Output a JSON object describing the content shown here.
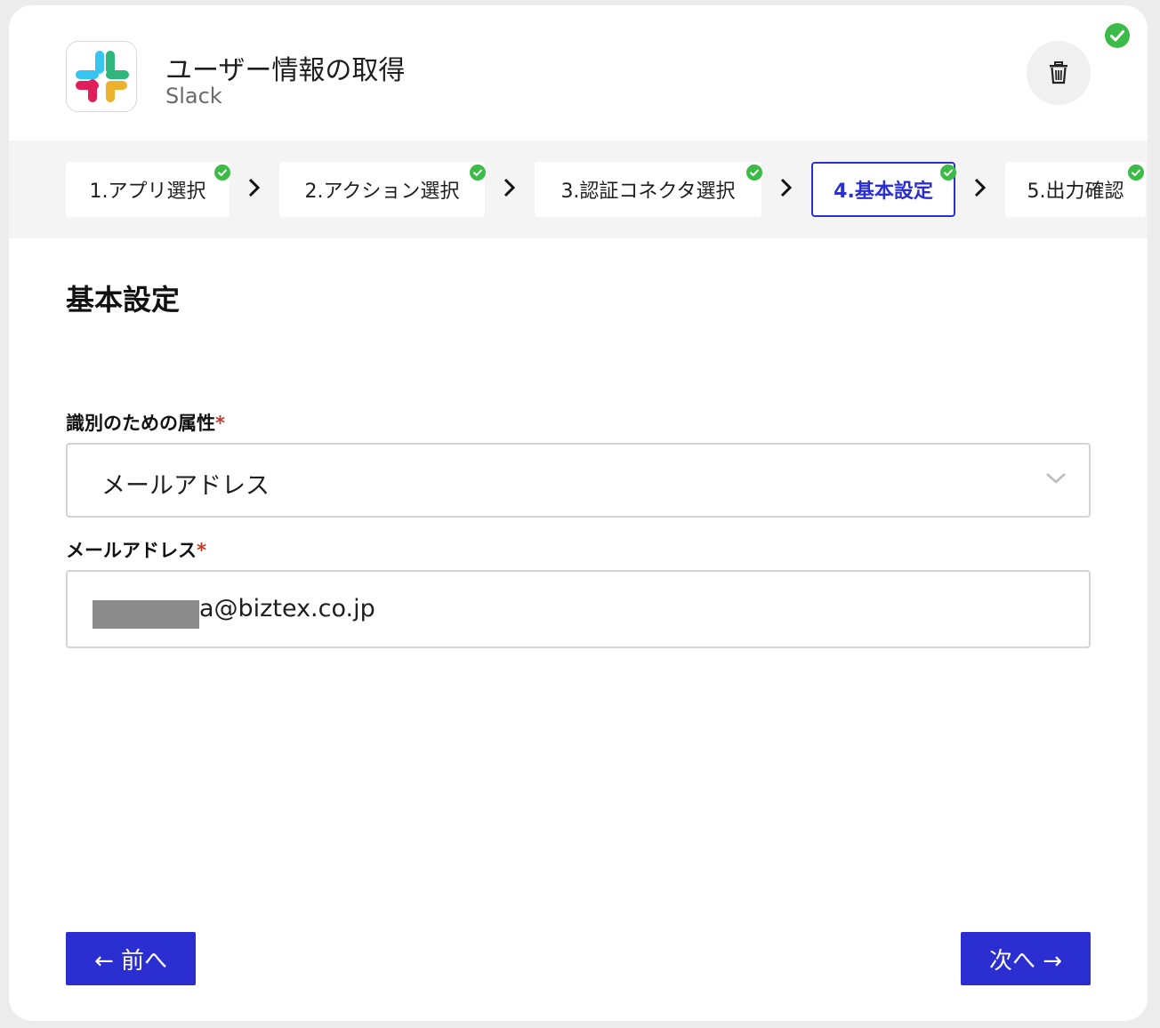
{
  "header": {
    "title": "ユーザー情報の取得",
    "subtitle": "Slack",
    "app_icon": "slack-logo-icon",
    "delete_icon": "trash-icon",
    "status_icon": "check-circle-icon"
  },
  "stepper": {
    "steps": [
      {
        "label": "1.アプリ選択",
        "done": true,
        "active": false
      },
      {
        "label": "2.アクション選択",
        "done": true,
        "active": false
      },
      {
        "label": "3.認証コネクタ選択",
        "done": true,
        "active": false
      },
      {
        "label": "4.基本設定",
        "done": true,
        "active": true
      },
      {
        "label": "5.出力確認",
        "done": true,
        "active": false
      }
    ]
  },
  "main": {
    "section_title": "基本設定",
    "fields": {
      "identifier": {
        "label": "識別のための属性",
        "required_mark": "*",
        "value": "メールアドレス"
      },
      "email": {
        "label": "メールアドレス",
        "required_mark": "*",
        "value": "a@biztex.co.jp"
      }
    }
  },
  "footer": {
    "prev_label": "← 前へ",
    "next_label": "次へ →"
  },
  "colors": {
    "accent": "#2b2ed1",
    "success": "#3dbb49",
    "required": "#c0392b"
  }
}
